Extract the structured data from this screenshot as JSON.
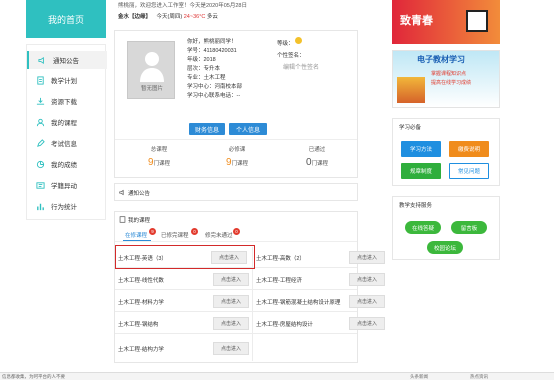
{
  "header": {
    "welcome": "熊桃丽，欢迎您进入工作室！今天是2020年05月28日",
    "weather_city": "金水【边缘】",
    "weather_today": "今天(周四)",
    "weather_temp": "24~36°C",
    "weather_desc": "多云"
  },
  "sidebar": {
    "title": "我的首页",
    "items": [
      {
        "label": "通知公告",
        "icon": "speaker-icon"
      },
      {
        "label": "教学计划",
        "icon": "document-icon"
      },
      {
        "label": "资源下载",
        "icon": "download-icon"
      },
      {
        "label": "我的课程",
        "icon": "person-icon"
      },
      {
        "label": "考试信息",
        "icon": "pencil-icon"
      },
      {
        "label": "我的成绩",
        "icon": "chart-icon"
      },
      {
        "label": "学籍异动",
        "icon": "id-card-icon"
      },
      {
        "label": "行为统计",
        "icon": "bars-icon"
      }
    ]
  },
  "profile": {
    "photo_label": "暂无图片",
    "greeting": "你好，熊桃丽同学！",
    "student_no": "学号：41180420031",
    "grade": "年级：2018",
    "level": "层次：专升本",
    "major": "专业：土木工程",
    "center": "学习中心：河南校本部",
    "contact": "学习中心联系电话：--",
    "rank_label": "等级：",
    "signature_label": "个性签名：",
    "edit_signature": "编辑个性签名",
    "finance_button": "财务信息",
    "personal_button": "个人信息"
  },
  "stats": [
    {
      "title": "总课程",
      "value": "9",
      "unit": "门课程"
    },
    {
      "title": "必修课",
      "value": "9",
      "unit": "门课程"
    },
    {
      "title": "已通过",
      "value": "0",
      "unit": "门课程"
    }
  ],
  "notice": {
    "title": "通知公告"
  },
  "courses": {
    "title": "我的课程",
    "tabs": [
      {
        "label": "在修课程",
        "badge": "9"
      },
      {
        "label": "已修完课程",
        "badge": "0"
      },
      {
        "label": "修完未通过",
        "badge": "0"
      }
    ],
    "enter_label": "点击进入",
    "left": [
      "土木工程-英语（3）",
      "土木工程-线性代数",
      "土木工程-材料力学",
      "土木工程-钢结构",
      "土木工程-结构力学"
    ],
    "right": [
      "土木工程-高数（2）",
      "土木工程-工程经济",
      "土木工程-钢筋混凝土结构设计原理",
      "土木工程-房屋结构设计"
    ]
  },
  "right_panel": {
    "banner1": "致青春",
    "banner2_title": "电子教材学习",
    "banner2_line1": "掌握课程知识点",
    "banner2_line2": "提高在线学习成绩",
    "tools_title": "学习必备",
    "tools": [
      {
        "label": "学习方法",
        "color": "#1f8fe0"
      },
      {
        "label": "缴费说明",
        "color": "#f08c1c"
      },
      {
        "label": "规章制度",
        "color": "#2fae3c"
      },
      {
        "label": "常见问题",
        "color": "#ffffff"
      }
    ],
    "service_title": "教学支持服务",
    "services": [
      "在线答疑",
      "留言板",
      "校园论坛"
    ]
  },
  "statusbar": {
    "left": "信息都收集，为呵平台的人不要",
    "items": [
      "头条新闻",
      "热点资讯"
    ]
  }
}
